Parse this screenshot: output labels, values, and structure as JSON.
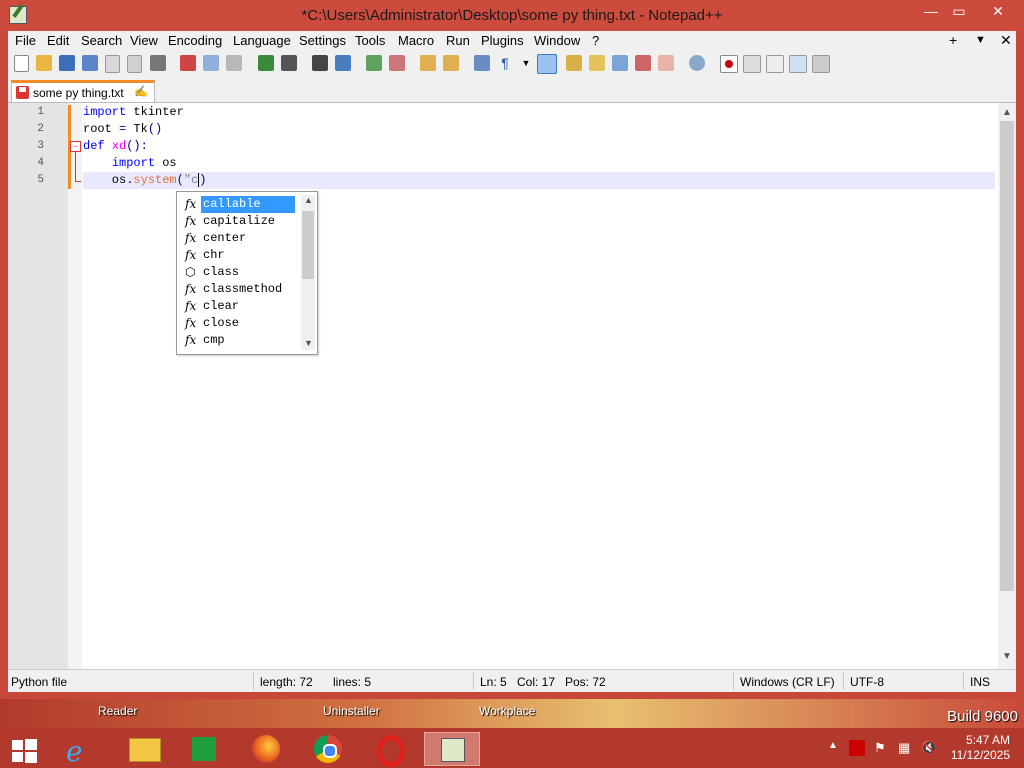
{
  "window": {
    "title": "*C:\\Users\\Administrator\\Desktop\\some py thing.txt - Notepad++",
    "min": "—",
    "max": "▭",
    "close": "✕"
  },
  "menu": {
    "items": [
      "File",
      "Edit",
      "Search",
      "View",
      "Encoding",
      "Language",
      "Settings",
      "Tools",
      "Macro",
      "Run",
      "Plugins",
      "Window",
      "?"
    ],
    "right_plus": "+",
    "right_down": "▼",
    "right_close": "✕"
  },
  "tab": {
    "label": "some py thing.txt",
    "pin": "✍"
  },
  "editor": {
    "line_numbers": [
      "1",
      "2",
      "3",
      "4",
      "5"
    ],
    "fold_marker": "−"
  },
  "autocomplete": {
    "items": [
      {
        "icon": "fx",
        "label": "callable"
      },
      {
        "icon": "fx",
        "label": "capitalize"
      },
      {
        "icon": "fx",
        "label": "center"
      },
      {
        "icon": "fx",
        "label": "chr"
      },
      {
        "icon": "cube",
        "label": "class"
      },
      {
        "icon": "fx",
        "label": "classmethod"
      },
      {
        "icon": "fx",
        "label": "clear"
      },
      {
        "icon": "fx",
        "label": "close"
      },
      {
        "icon": "fx",
        "label": "cmp"
      }
    ],
    "selected_index": 0
  },
  "status": {
    "language": "Python file",
    "length": "length: 72",
    "lines": "lines: 5",
    "ln": "Ln: 5",
    "col": "Col: 17",
    "pos": "Pos: 72",
    "eol": "Windows (CR LF)",
    "encoding": "UTF-8",
    "mode": "INS"
  },
  "desktop": {
    "labels": [
      "Reader",
      "Uninstaller",
      "Workplace"
    ],
    "build": "Build 9600"
  },
  "taskbar": {
    "time": "5:47 AM",
    "date": "11/12/2025"
  },
  "colors": {
    "accent": "#f28c28",
    "keyword": "#0000ff",
    "function": "#ff00ff",
    "selection": "#3399ff",
    "frame": "#cd4b3d"
  }
}
